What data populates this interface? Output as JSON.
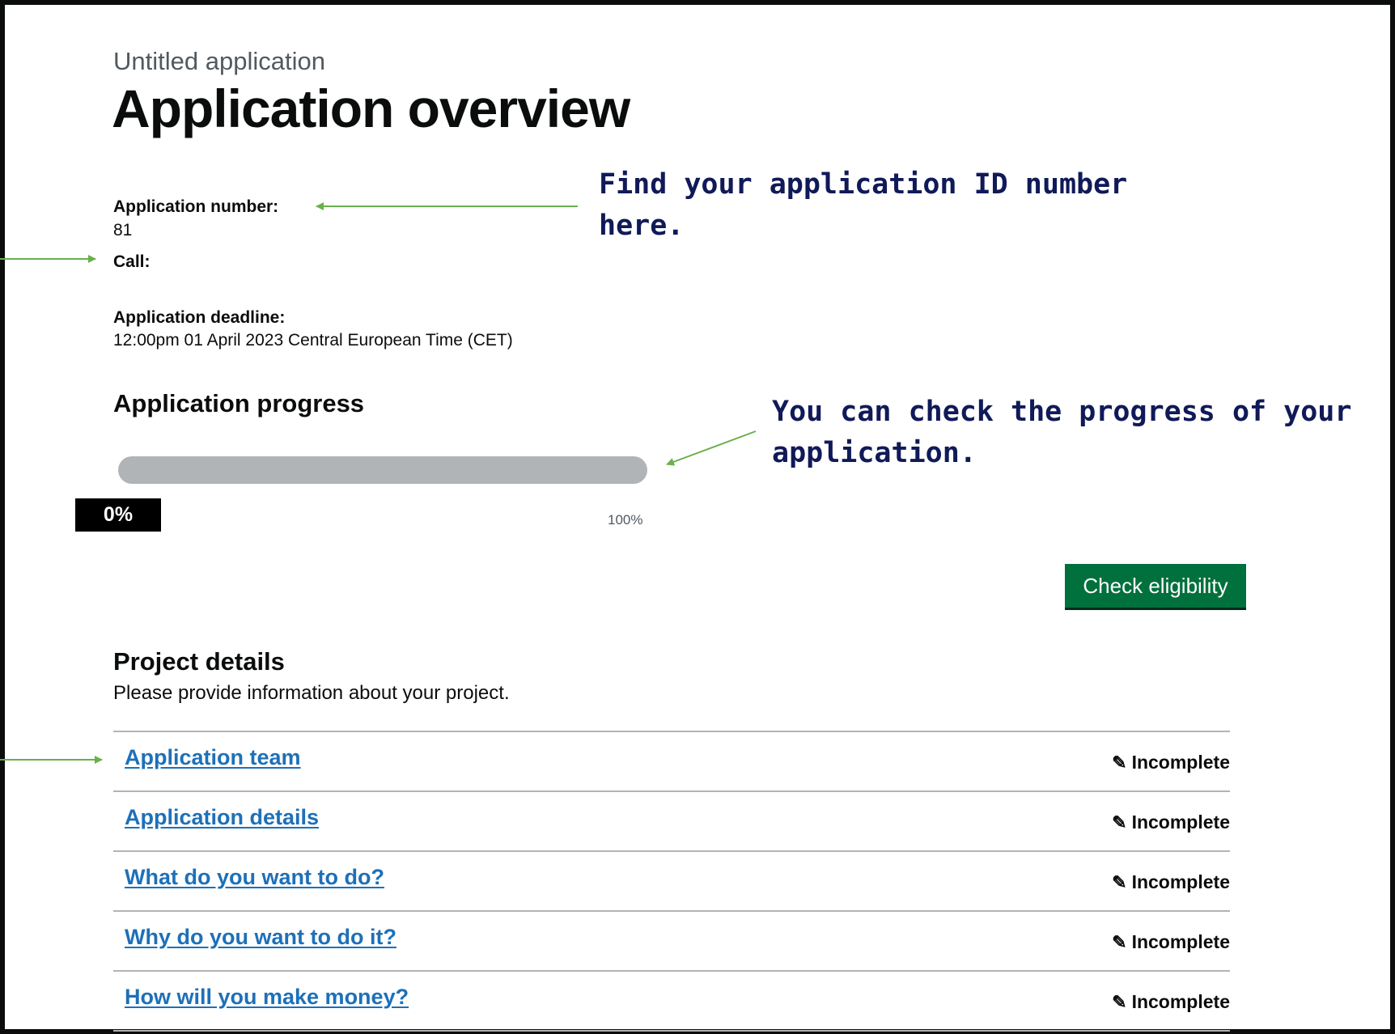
{
  "header": {
    "caption": "Untitled application",
    "title": "Application overview"
  },
  "meta": {
    "number_label": "Application number:",
    "number_value": "81",
    "call_label": "Call:",
    "deadline_label": "Application deadline:",
    "deadline_value": "12:00pm 01 April 2023 Central European Time (CET)"
  },
  "progress": {
    "heading": "Application progress",
    "value_percent": 0,
    "value_label": "0%",
    "end_label": "100%"
  },
  "actions": {
    "check_eligibility": "Check eligibility"
  },
  "project": {
    "heading": "Project details",
    "description": "Please provide information about your project.",
    "tasks": [
      {
        "label": "Application team",
        "status": "Incomplete"
      },
      {
        "label": "Application details",
        "status": "Incomplete"
      },
      {
        "label": "What do you want to do?",
        "status": "Incomplete"
      },
      {
        "label": "Why do you want to do it?",
        "status": "Incomplete"
      },
      {
        "label": "How will you make money?",
        "status": "Incomplete"
      }
    ]
  },
  "annotations": {
    "id_note_line1": "Find your application ID number",
    "id_note_line2": "here.",
    "progress_note_line1": "You can check the progress of your",
    "progress_note_line2": "application."
  },
  "colors": {
    "link": "#1d70b8",
    "button": "#00703c",
    "arrow": "#6ab04c",
    "annotation_text": "#101a58",
    "progress_track": "#b1b4b6"
  },
  "icons": {
    "status": "pencil-icon",
    "arrow": "arrow-icon"
  }
}
